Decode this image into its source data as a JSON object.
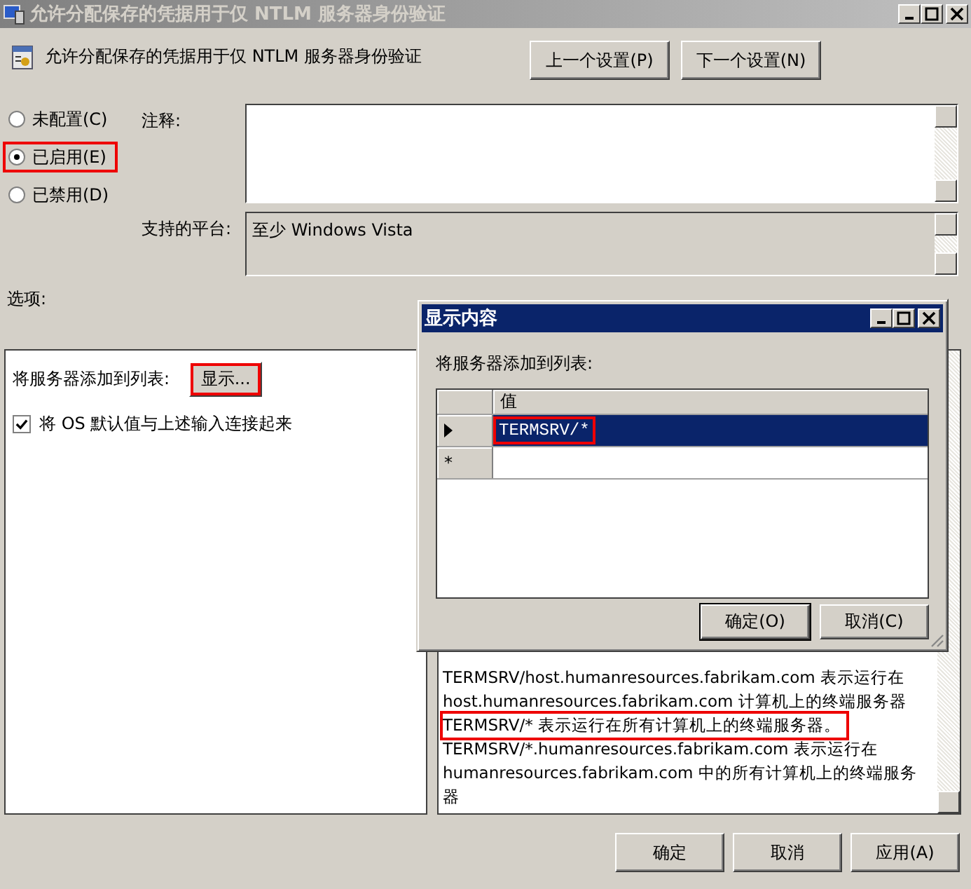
{
  "window": {
    "title": "允许分配保存的凭据用于仅 NTLM 服务器身份验证",
    "active": false
  },
  "header": {
    "title": "允许分配保存的凭据用于仅 NTLM 服务器身份验证",
    "buttons": [
      "上一个设置(P)",
      "下一个设置(N)"
    ]
  },
  "state_options": [
    {
      "label": "未配置(C)",
      "selected": false,
      "highlighted": false
    },
    {
      "label": "已启用(E)",
      "selected": true,
      "highlighted": true
    },
    {
      "label": "已禁用(D)",
      "selected": false,
      "highlighted": false
    }
  ],
  "comment": {
    "label": "注释:"
  },
  "platform": {
    "label": "支持的平台:",
    "value": "至少 Windows Vista"
  },
  "options": {
    "label": "选项:",
    "list_label": "将服务器添加到列表:",
    "show_button": {
      "label": "显示...",
      "highlighted": true
    },
    "concat": {
      "label": "将 OS 默认值与上述输入连接起来",
      "checked": true
    }
  },
  "help": {
    "lines": [
      {
        "text": "TERMSRV/host.humanresources.fabrikam.com 表示运行在",
        "highlighted": false
      },
      {
        "text": "host.humanresources.fabrikam.com 计算机上的终端服务器",
        "highlighted": false
      },
      {
        "text": "TERMSRV/* 表示运行在所有计算机上的终端服务器。",
        "highlighted": true
      },
      {
        "text": "TERMSRV/*.humanresources.fabrikam.com 表示运行在",
        "highlighted": false
      },
      {
        "text": "humanresources.fabrikam.com 中的所有计算机上的终端服务",
        "highlighted": false
      },
      {
        "text": "器",
        "highlighted": false
      }
    ]
  },
  "buttons": [
    "确定",
    "取消",
    "应用(A)"
  ],
  "dialog": {
    "title": "显示内容",
    "label": "将服务器添加到列表:",
    "column": "值",
    "new_row_marker": "*",
    "rows": [
      {
        "value": "TERMSRV/*",
        "selected": true,
        "highlighted": true
      }
    ],
    "buttons": [
      "确定(O)",
      "取消(C)"
    ]
  }
}
